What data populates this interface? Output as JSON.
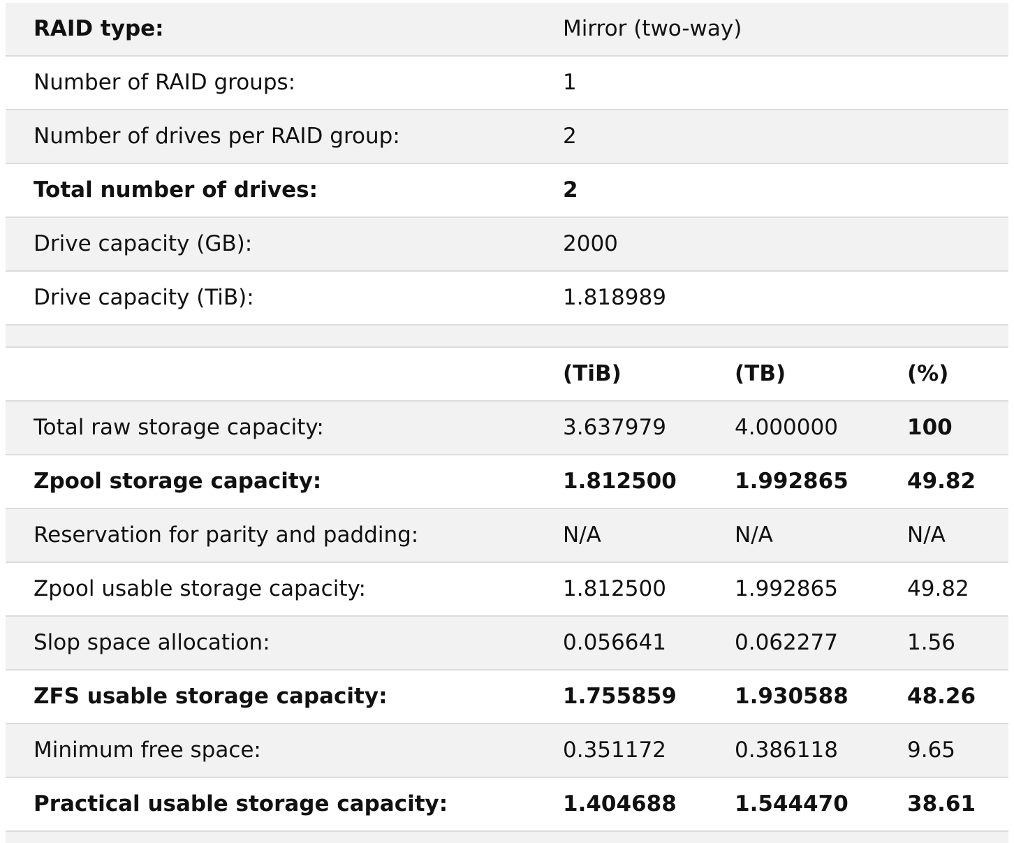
{
  "config": {
    "raid_type": {
      "label": "RAID type:",
      "value": "Mirror (two-way)"
    },
    "raid_groups": {
      "label": "Number of RAID groups:",
      "value": "1"
    },
    "drives_per_group": {
      "label": "Number of drives per RAID group:",
      "value": "2"
    },
    "total_drives": {
      "label": "Total number of drives:",
      "value": "2"
    },
    "drive_capacity_gb": {
      "label": "Drive capacity (GB):",
      "value": "2000"
    },
    "drive_capacity_tib": {
      "label": "Drive capacity (TiB):",
      "value": "1.818989"
    }
  },
  "capacity": {
    "headers": {
      "tib": "(TiB)",
      "tb": "(TB)",
      "pct": "(%)"
    },
    "rows": [
      {
        "label": "Total raw storage capacity:",
        "tib": "3.637979",
        "tb": "4.000000",
        "pct": "100"
      },
      {
        "label": "Zpool storage capacity:",
        "tib": "1.812500",
        "tb": "1.992865",
        "pct": "49.82"
      },
      {
        "label": "Reservation for parity and padding:",
        "tib": "N/A",
        "tb": "N/A",
        "pct": "N/A"
      },
      {
        "label": "Zpool usable storage capacity:",
        "tib": "1.812500",
        "tb": "1.992865",
        "pct": "49.82"
      },
      {
        "label": "Slop space allocation:",
        "tib": "0.056641",
        "tb": "0.062277",
        "pct": "1.56"
      },
      {
        "label": "ZFS usable storage capacity:",
        "tib": "1.755859",
        "tb": "1.930588",
        "pct": "48.26"
      },
      {
        "label": "Minimum free space:",
        "tib": "0.351172",
        "tb": "0.386118",
        "pct": "9.65"
      },
      {
        "label": "Practical usable storage capacity:",
        "tib": "1.404688",
        "tb": "1.544470",
        "pct": "38.61"
      }
    ]
  }
}
